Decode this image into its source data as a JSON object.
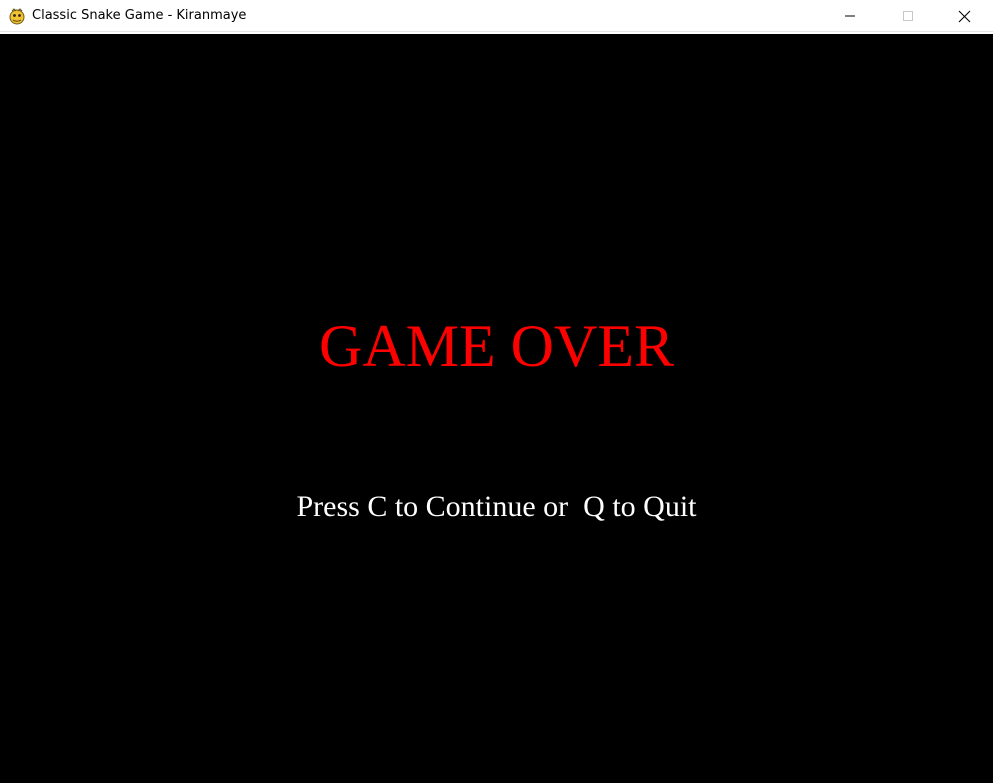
{
  "window": {
    "title": "Classic Snake Game - Kiranmaye",
    "icon": "pygame-snake-icon",
    "controls": {
      "minimize": "minimize-icon",
      "maximize": "maximize-icon",
      "close": "close-icon"
    }
  },
  "game": {
    "headline": "GAME OVER",
    "prompt": "Press C to Continue or  Q to Quit",
    "colors": {
      "background": "#000000",
      "headline": "#ff0000",
      "prompt": "#ffffff"
    }
  }
}
